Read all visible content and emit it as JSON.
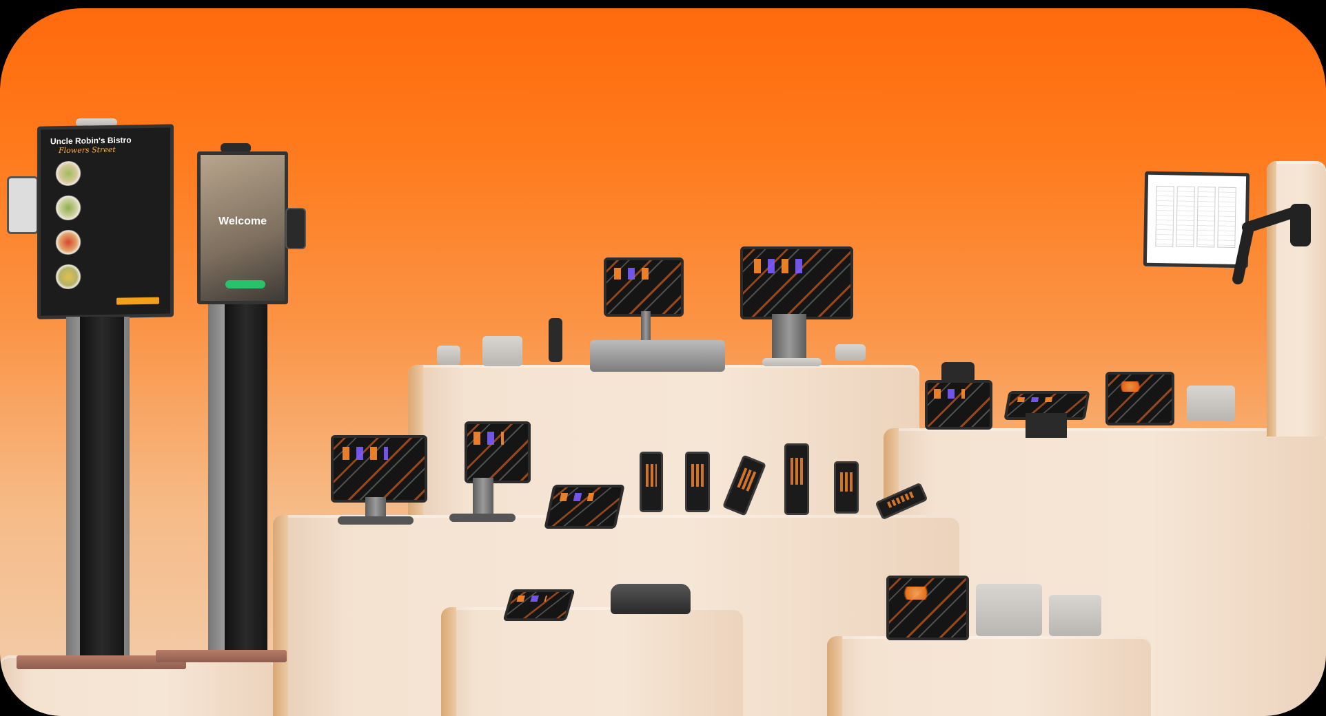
{
  "kiosk_menu": {
    "title": "Uncle Robin's Bistro",
    "subtitle": "Flowers Street"
  },
  "kiosk_welcome": {
    "heading": "Welcome"
  },
  "colors": {
    "background_top": "#ff6a0d",
    "background_bottom": "#f2cfb0",
    "platform": "#f5e3d2",
    "accent": "#f5a01a",
    "order_button": "#27c26b"
  }
}
